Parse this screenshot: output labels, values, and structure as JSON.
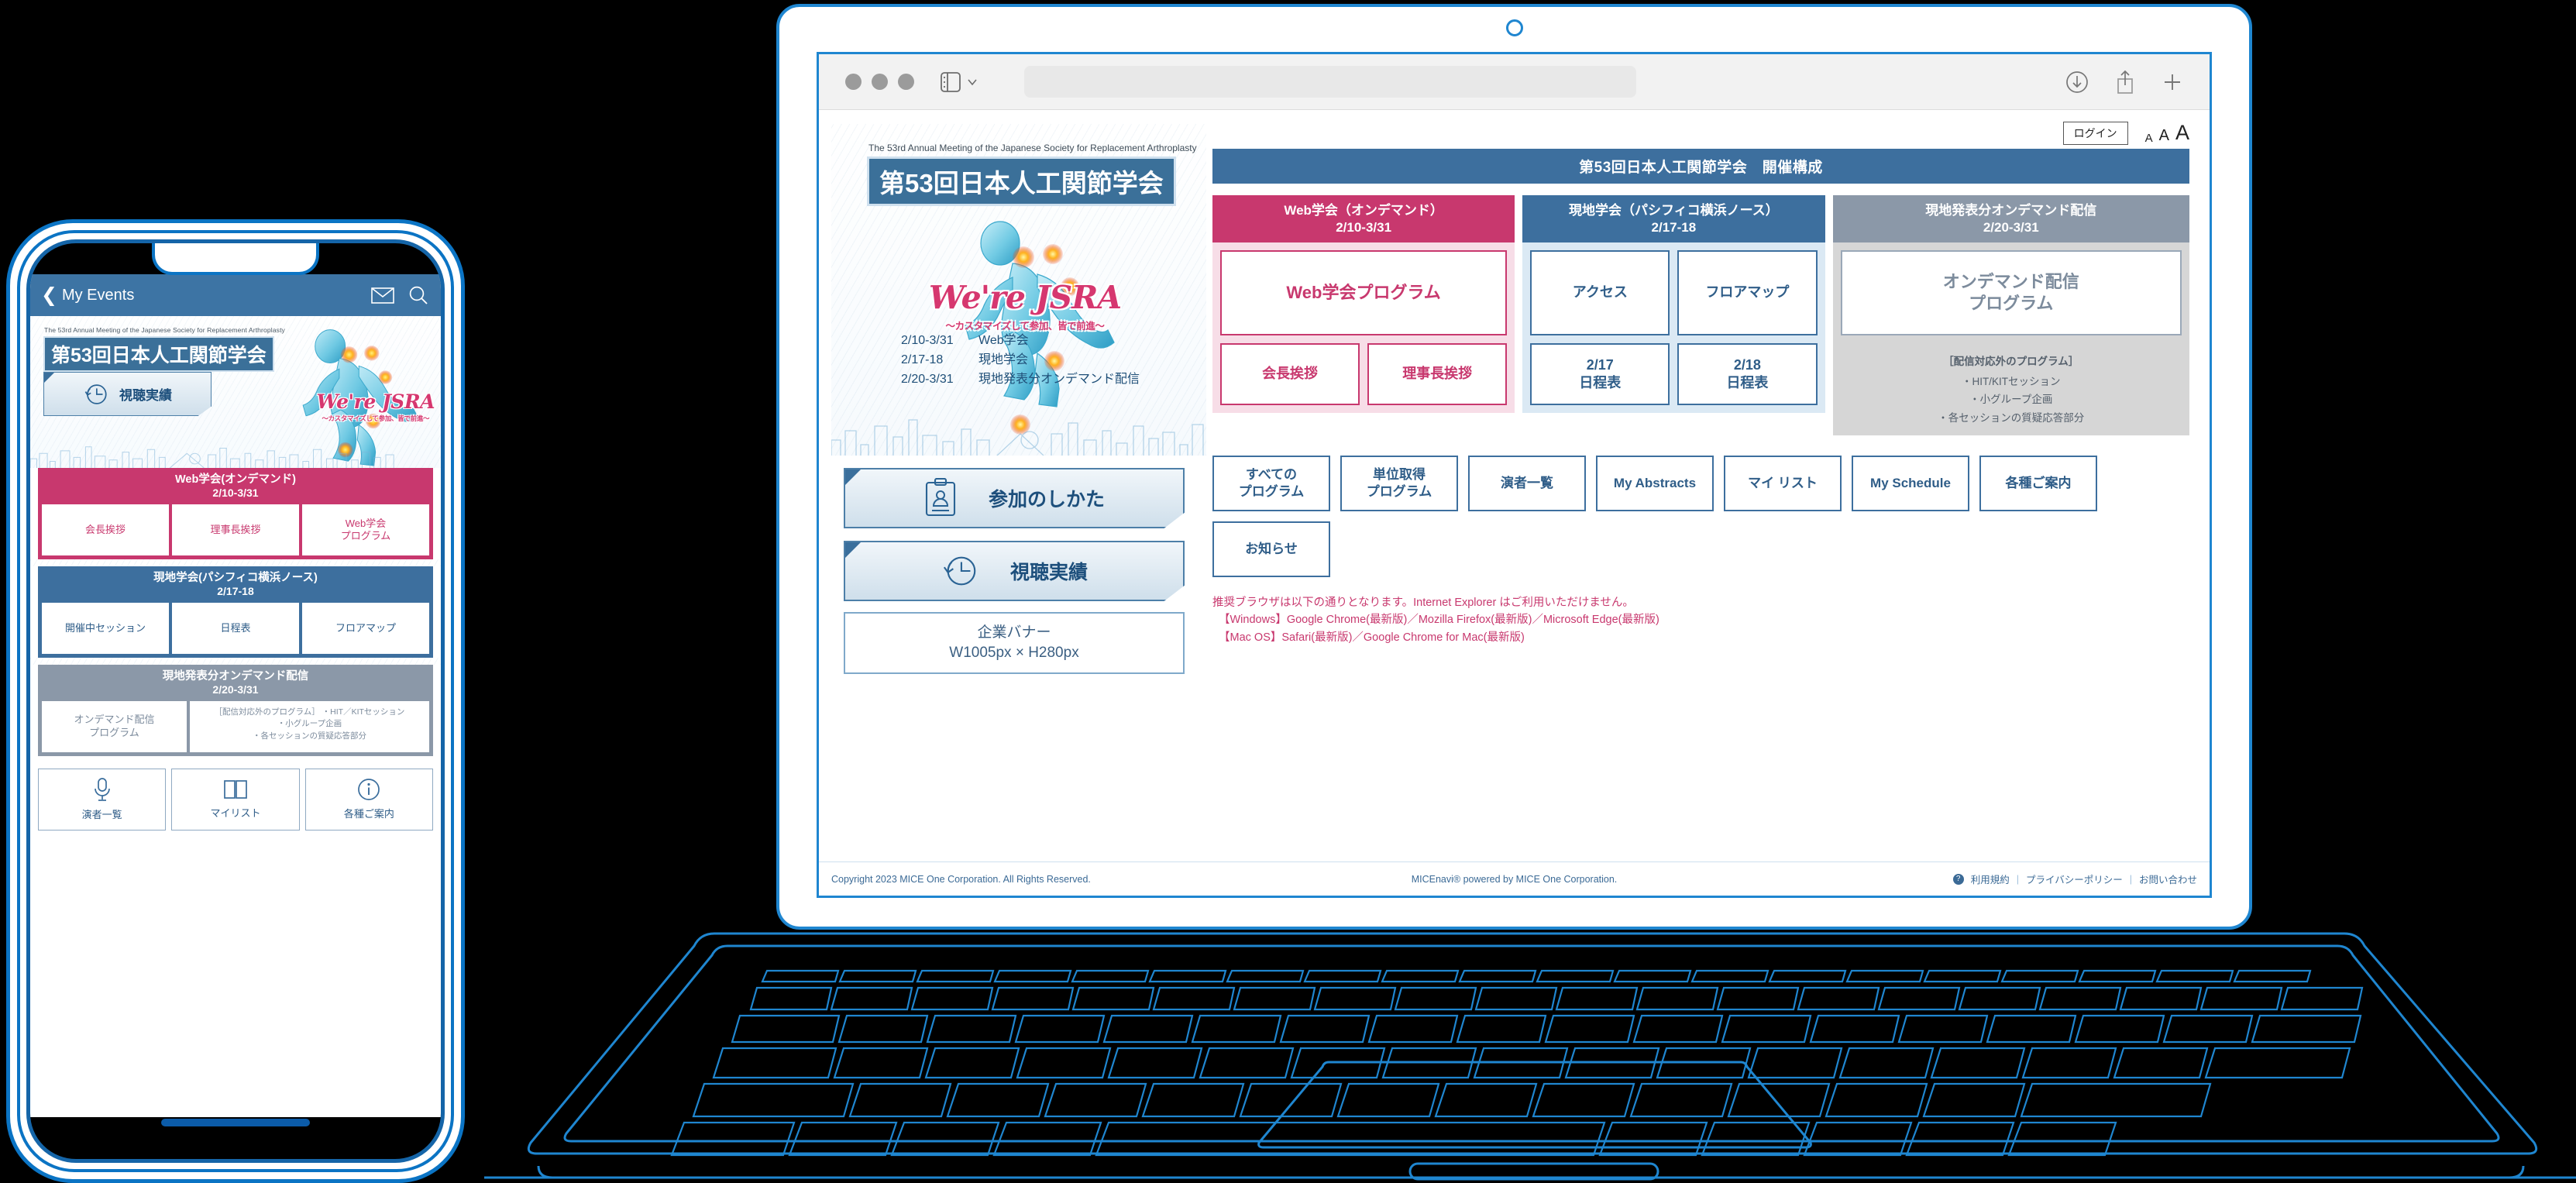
{
  "phone": {
    "statusbar": {
      "back_label": "My Events",
      "mail_icon": "mail-icon",
      "search_icon": "search-icon"
    },
    "hero": {
      "english_title": "The 53rd Annual Meeting of the Japanese Society for Replacement Arthroplasty",
      "title": "第53回日本人工関節学会",
      "watch_button": "視聴実績",
      "jsra_logo": "We're JSRA",
      "jsra_tagline": "〜カスタマイズして参加、皆で前進〜"
    },
    "panels": [
      {
        "id": "web",
        "color": "#c8386e",
        "title": "Web学会(オンデマンド)",
        "dates": "2/10-3/31",
        "cells": [
          "会長挨拶",
          "理事長挨拶",
          "Web学会\nプログラム"
        ]
      },
      {
        "id": "onsite",
        "color": "#3d6f9e",
        "title": "現地学会(パシフィコ横浜ノース)",
        "dates": "2/17-18",
        "cells": [
          "開催中セッション",
          "日程表",
          "フロアマップ"
        ]
      },
      {
        "id": "ondemand",
        "color": "#8b98a8",
        "title": "現地発表分オンデマンド配信",
        "dates": "2/20-3/31",
        "cells": [
          "オンデマンド配信\nプログラム"
        ],
        "note_title": "［配信対応外のプログラム］",
        "note_items": [
          "・HIT／KITセッション",
          "・小グループ企画",
          "・各セッションの質疑応答部分"
        ]
      }
    ],
    "bottom_nav": [
      {
        "label": "演者一覧",
        "icon": "microphone-icon"
      },
      {
        "label": "マイリスト",
        "icon": "book-icon"
      },
      {
        "label": "各種ご案内",
        "icon": "info-icon"
      }
    ]
  },
  "laptop": {
    "browser": {
      "traffic_lights": [
        "close",
        "minimize",
        "zoom"
      ],
      "sidebar_icon": "sidebar-icon",
      "chevron_icon": "chevron-down-icon",
      "url_value": "",
      "url_placeholder": "",
      "download_icon": "download-icon",
      "share_icon": "share-icon",
      "newtab_icon": "plus-icon"
    },
    "header": {
      "login_label": "ログイン",
      "font_sizes": [
        "A",
        "A",
        "A"
      ]
    },
    "hero": {
      "english_title": "The 53rd Annual Meeting of the Japanese Society for Replacement Arthroplasty",
      "title": "第53回日本人工関節学会",
      "jsra_logo": "We're JSRA",
      "jsra_tagline": "〜カスタマイズして参加、皆で前進〜",
      "schedule": [
        {
          "date": "2/10-3/31",
          "label": "Web学会"
        },
        {
          "date": "2/17-18",
          "label": "現地学会"
        },
        {
          "date": "2/20-3/31",
          "label": "現地発表分オンデマンド配信"
        }
      ]
    },
    "left_buttons": [
      {
        "label": "参加のしかた",
        "icon": "clipboard-person-icon",
        "accent": "#c8386e"
      },
      {
        "label": "視聴実績",
        "icon": "clock-history-icon",
        "accent": "#3fa8bf"
      }
    ],
    "banner": {
      "line1": "企業バナー",
      "line2": "W1005px × H280px"
    },
    "section_title": "第53回日本人工関節学会　開催構成",
    "columns": [
      {
        "id": "web",
        "title": "Web学会（オンデマンド）",
        "dates": "2/10-3/31",
        "big_cell": "Web学会プログラム",
        "half_cells": [
          "会長挨拶",
          "理事長挨拶"
        ]
      },
      {
        "id": "onsite",
        "title": "現地学会（パシフィコ横浜ノース）",
        "dates": "2/17-18",
        "half_top": [
          "アクセス",
          "フロアマップ"
        ],
        "half_bottom": [
          "2/17\n日程表",
          "2/18\n日程表"
        ]
      },
      {
        "id": "ondemand",
        "title": "現地発表分オンデマンド配信",
        "dates": "2/20-3/31",
        "big_cell": "オンデマンド配信\nプログラム",
        "note_title": "［配信対応外のプログラム］",
        "note_items": [
          "・HIT/KITセッション",
          "・小グループ企画",
          "・各セッションの質疑応答部分"
        ]
      }
    ],
    "button_grid": [
      "すべての\nプログラム",
      "単位取得\nプログラム",
      "演者一覧",
      "My Abstracts",
      "マイ リスト",
      "My Schedule",
      "各種ご案内",
      "お知らせ"
    ],
    "browser_note": [
      "推奨ブラウザは以下の通りとなります。Internet Explorer はご利用いただけません。",
      "【Windows】Google Chrome(最新版)／Mozilla Firefox(最新版)／Microsoft Edge(最新版)",
      "【Mac OS】Safari(最新版)／Google Chrome for Mac(最新版)"
    ],
    "footer": {
      "copyright": "Copyright 2023 MICE One Corporation. All Rights Reserved.",
      "powered": "MICEnavi® powered by MICE One Corporation.",
      "links": [
        "利用規約",
        "プライバシーポリシー",
        "お問い合わせ"
      ]
    }
  },
  "colors": {
    "pink": "#c8386e",
    "blue": "#3d6f9e",
    "gray": "#8b98a8",
    "device_outline": "#1f86d0",
    "phone_outline": "#0b74c4"
  }
}
